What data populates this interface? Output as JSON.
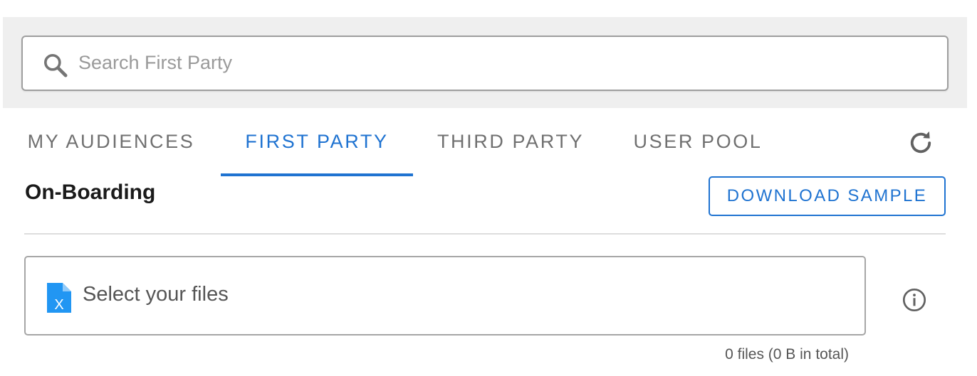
{
  "search": {
    "placeholder": "Search First Party",
    "value": ""
  },
  "tabs": [
    {
      "label": "MY AUDIENCES",
      "active": false
    },
    {
      "label": "FIRST PARTY",
      "active": true
    },
    {
      "label": "THIRD PARTY",
      "active": false
    },
    {
      "label": "USER POOL",
      "active": false
    }
  ],
  "section": {
    "title": "On-Boarding",
    "download_label": "DOWNLOAD SAMPLE"
  },
  "upload": {
    "label": "Select your files",
    "summary": "0 files (0 B in total)",
    "file_icon_letter": "X"
  },
  "icons": {
    "search": "search-icon",
    "refresh": "refresh-icon",
    "file": "excel-file-icon",
    "info": "info-icon"
  },
  "colors": {
    "accent": "#1f73d1",
    "file_icon": "#2196f3",
    "panel_background": "#efefef",
    "tab_inactive": "#707070"
  }
}
